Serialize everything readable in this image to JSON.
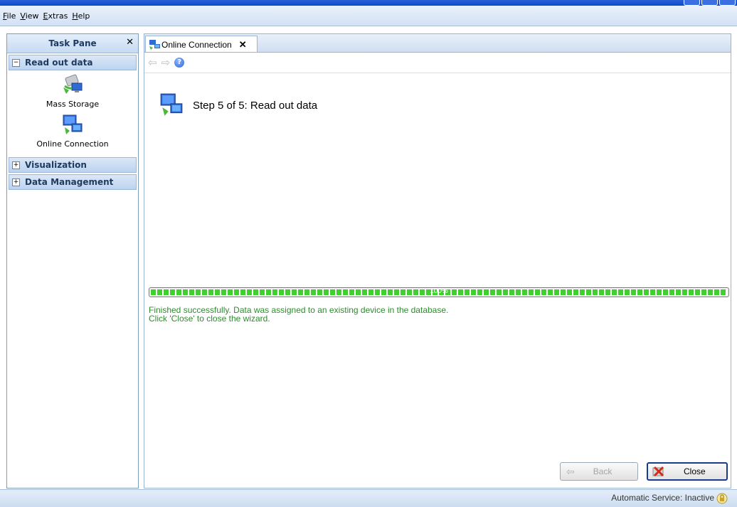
{
  "menu": {
    "items": [
      {
        "first": "F",
        "rest": "ile"
      },
      {
        "first": "V",
        "rest": "iew"
      },
      {
        "first": "E",
        "rest": "xtras"
      },
      {
        "first": "H",
        "rest": "elp"
      }
    ]
  },
  "taskpane": {
    "title": "Task Pane",
    "close": "✕",
    "groups": [
      {
        "toggle": "−",
        "label": "Read out data",
        "items": [
          {
            "label": "Mass Storage",
            "icon": "mass-storage-icon"
          },
          {
            "label": "Online Connection",
            "icon": "online-connection-icon"
          }
        ]
      },
      {
        "toggle": "+",
        "label": "Visualization"
      },
      {
        "toggle": "+",
        "label": "Data Management"
      }
    ]
  },
  "tab": {
    "label": "Online Connection",
    "close": "✕"
  },
  "nav": {
    "back": "⇦",
    "forward": "⇨",
    "help": "?"
  },
  "wizard": {
    "step_title": "Step 5 of 5: Read out data",
    "progress_percent": 100,
    "progress_label": "100%",
    "status_line1": "Finished successfully. Data was assigned to an existing device in the database.",
    "status_line2": "Click 'Close' to close the wizard."
  },
  "buttons": {
    "back": "Back",
    "close": "Close"
  },
  "statusbar": {
    "text": "Automatic Service: Inactive"
  },
  "colors": {
    "progress": "#3fcf2f",
    "status_text": "#2e8b2e"
  }
}
